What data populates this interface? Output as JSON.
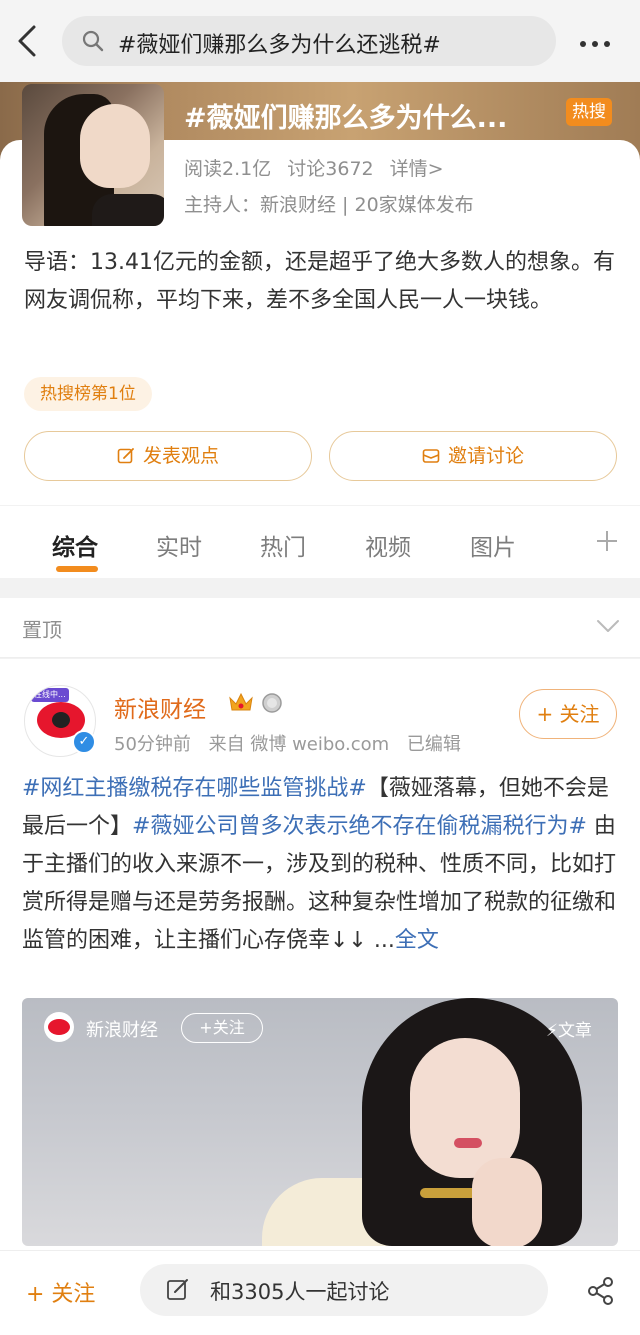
{
  "search": {
    "query": "#薇娅们赚那么多为什么还逃税#"
  },
  "topic": {
    "title": "#薇娅们赚那么多为什么...",
    "hot_badge": "热搜",
    "reads": "阅读2.1亿",
    "discussions": "讨论3672",
    "details": "详情>",
    "host": "主持人：新浪财经 | 20家媒体发布",
    "intro": "导语：13.41亿元的金额，还是超乎了绝大多数人的想象。有网友调侃称，平均下来，差不多全国人民一人一块钱。",
    "rank_tag": "热搜榜第1位",
    "post_button": "发表观点",
    "invite_button": "邀请讨论"
  },
  "tabs": [
    {
      "label": "综合"
    },
    {
      "label": "实时"
    },
    {
      "label": "热门"
    },
    {
      "label": "视频"
    },
    {
      "label": "图片"
    }
  ],
  "pinned": {
    "label": "置顶"
  },
  "post": {
    "avatar_badge": "在线中...",
    "author": "新浪财经",
    "time": "50分钟前",
    "source": "来自 微博 weibo.com",
    "edited": "已编辑",
    "follow": "+ 关注",
    "tag1": "#网红主播缴税存在哪些监管挑战#",
    "text1": "【薇娅落幕，但她不会是最后一个】",
    "tag2": "#薇娅公司曾多次表示绝不存在偷税漏税行为#",
    "text2": " 由于主播们的收入来源不一，涉及到的税种、性质不同，比如打赏所得是赠与还是劳务报酬。这种复杂性增加了税款的征缴和监管的困难，让主播们心存侥幸↓↓   ...",
    "more": "全文"
  },
  "article": {
    "name": "新浪财经",
    "follow": "+关注",
    "type": "文章"
  },
  "bottom": {
    "follow": "+ 关注",
    "discuss": "和3305人一起讨论"
  },
  "colors": {
    "accent": "#f28c1e",
    "link": "#3d6fb6",
    "author": "#e06a1a"
  }
}
